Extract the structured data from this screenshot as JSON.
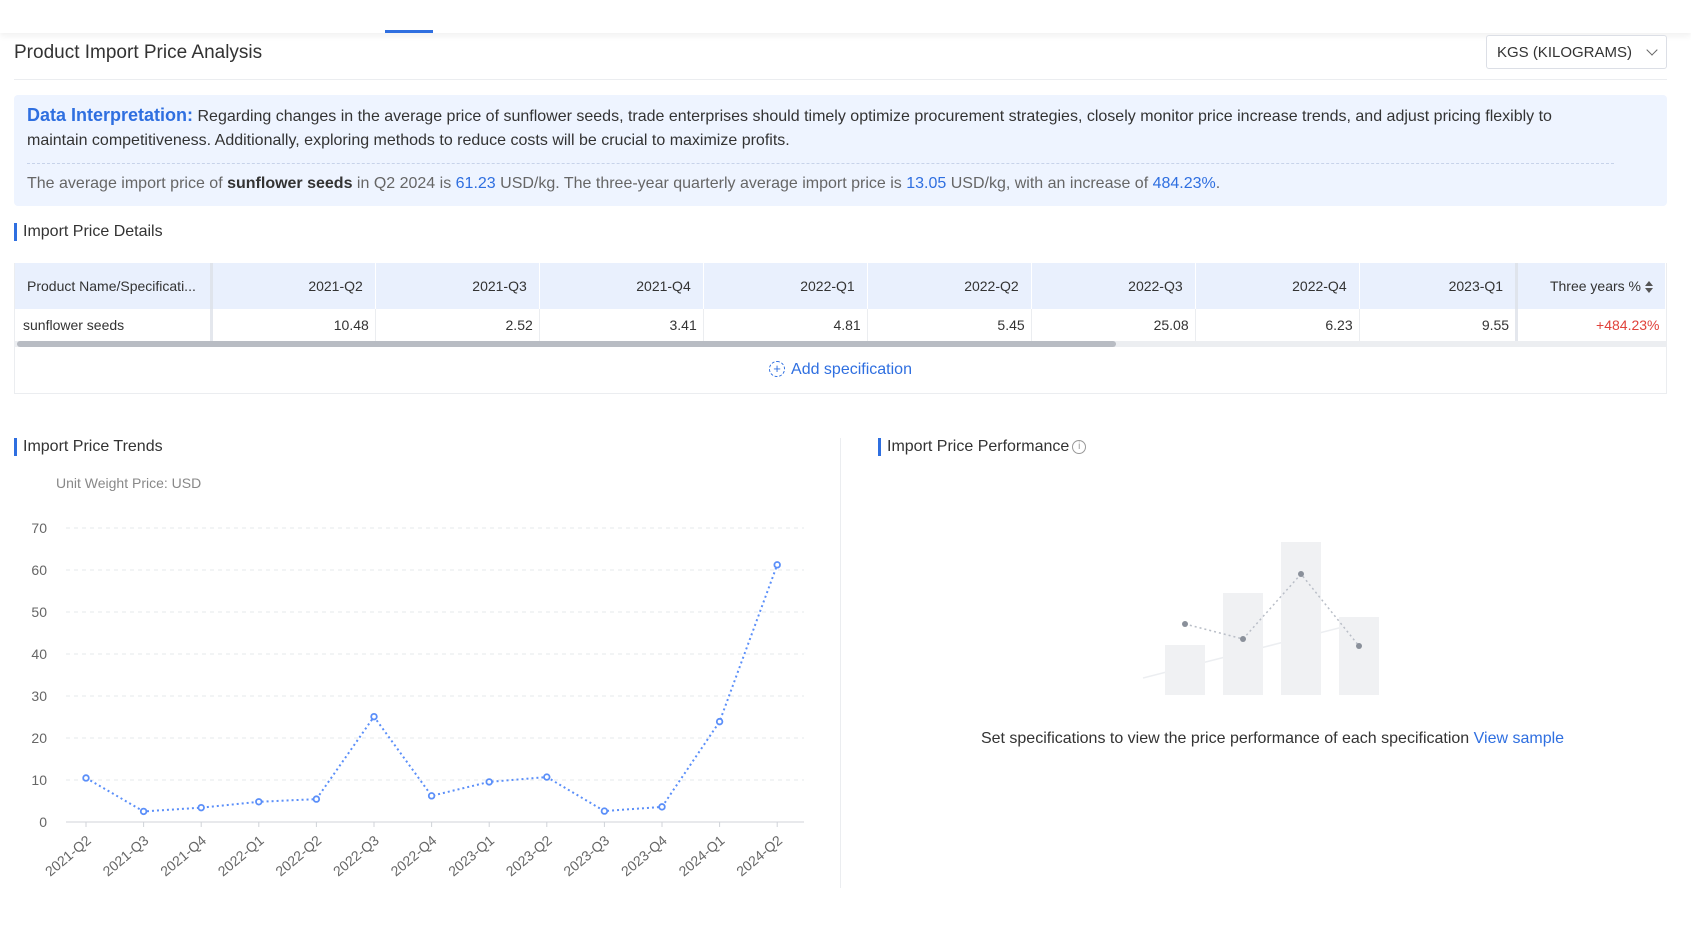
{
  "page": {
    "title": "Product Import Price Analysis",
    "unit_select": "KGS (KILOGRAMS)"
  },
  "interpretation": {
    "label": "Data Interpretation:",
    "text": "Regarding changes in the average price of sunflower seeds, trade enterprises should timely optimize procurement strategies, closely monitor price increase trends, and adjust pricing flexibly to maintain competitiveness. Additionally, exploring methods to reduce costs will be crucial to maximize profits.",
    "stats": {
      "p1": "The average import price of ",
      "product": "sunflower seeds",
      "p2": " in Q2 2024 is ",
      "price": "61.23",
      "p3": " USD/kg. The three-year quarterly average import price is ",
      "avg": "13.05",
      "p4": " USD/kg, with an increase of ",
      "increase": "484.23%",
      "p5": "."
    }
  },
  "details": {
    "title": "Import Price Details",
    "columns": [
      "Product Name/Specificati...",
      "2021-Q2",
      "2021-Q3",
      "2021-Q4",
      "2022-Q1",
      "2022-Q2",
      "2022-Q3",
      "2022-Q4",
      "2023-Q1",
      "Three years %"
    ],
    "row": [
      "sunflower seeds",
      "10.48",
      "2.52",
      "3.41",
      "4.81",
      "5.45",
      "25.08",
      "6.23",
      "9.55",
      "+484.23%"
    ],
    "add_spec": "Add specification"
  },
  "trend": {
    "title": "Import Price Trends"
  },
  "chart_data": {
    "type": "line",
    "ylabel": "Unit Weight Price: USD",
    "categories": [
      "2021-Q2",
      "2021-Q3",
      "2021-Q4",
      "2022-Q1",
      "2022-Q2",
      "2022-Q3",
      "2022-Q4",
      "2023-Q1",
      "2023-Q2",
      "2023-Q3",
      "2023-Q4",
      "2024-Q1",
      "2024-Q2"
    ],
    "values": [
      10.48,
      2.52,
      3.41,
      4.81,
      5.45,
      25.08,
      6.23,
      9.55,
      10.7,
      2.6,
      3.6,
      23.9,
      61.23
    ],
    "yticks": [
      0,
      10,
      20,
      30,
      40,
      50,
      60,
      70
    ],
    "ylim": [
      0,
      70
    ],
    "grid": true,
    "line_color": "#5b8ff9"
  },
  "performance": {
    "title": "Import Price Performance",
    "info_icon": "info-circle-icon",
    "empty_text": "Set specifications to view the price performance of each specification ",
    "view_sample": "View sample"
  }
}
